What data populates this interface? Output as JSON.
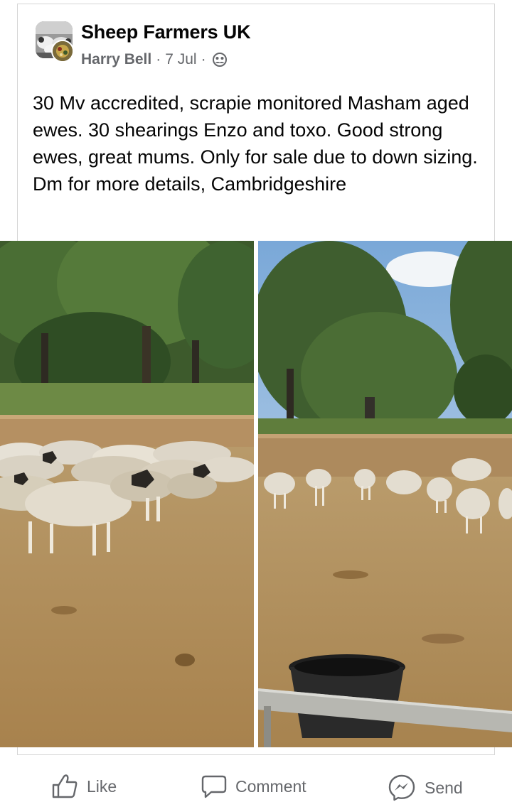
{
  "post": {
    "group_name": "Sheep Farmers UK",
    "author": "Harry Bell",
    "date": "7 Jul",
    "separator": "·",
    "audience_icon": "group-audience-icon",
    "text": "30 Mv accredited, scrapie monitored Masham aged ewes. 30 shearings Enzo and toxo. Good strong ewes, great mums. Only for sale due to down sizing. Dm for more details, Cambridgeshire"
  },
  "photos": [
    {
      "name": "photo-sheep-flock-trees",
      "icon": "photo"
    },
    {
      "name": "photo-sheep-pen-bucket",
      "icon": "photo"
    }
  ],
  "actions": {
    "like_label": "Like",
    "comment_label": "Comment",
    "send_label": "Send"
  },
  "colors": {
    "text_primary": "#050505",
    "text_secondary": "#65676b",
    "border": "#d6d6d6"
  }
}
